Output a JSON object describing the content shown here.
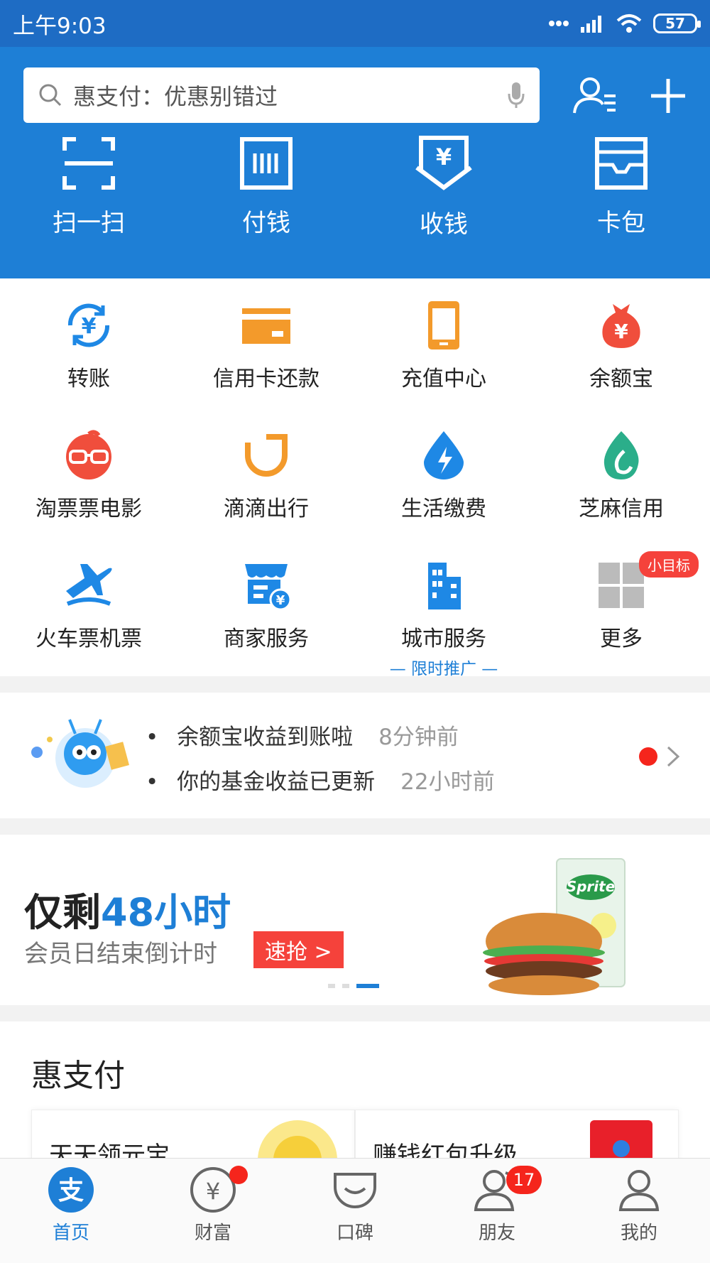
{
  "status_bar": {
    "time": "上午9:03",
    "battery": "57"
  },
  "header": {
    "search_placeholder": "惠支付：优惠别错过",
    "quick_actions": [
      {
        "label": "扫一扫",
        "icon": "scan-icon"
      },
      {
        "label": "付钱",
        "icon": "pay-icon"
      },
      {
        "label": "收钱",
        "icon": "receive-money-icon"
      },
      {
        "label": "卡包",
        "icon": "card-wallet-icon"
      }
    ]
  },
  "grid": {
    "items": [
      {
        "label": "转账",
        "icon": "transfer-icon"
      },
      {
        "label": "信用卡还款",
        "icon": "credit-card-icon"
      },
      {
        "label": "充值中心",
        "icon": "phone-recharge-icon"
      },
      {
        "label": "余额宝",
        "icon": "money-bag-icon"
      },
      {
        "label": "淘票票电影",
        "icon": "movie-glasses-icon"
      },
      {
        "label": "滴滴出行",
        "icon": "didi-icon"
      },
      {
        "label": "生活缴费",
        "icon": "lightning-drop-icon"
      },
      {
        "label": "芝麻信用",
        "icon": "sesame-credit-icon"
      },
      {
        "label": "火车票机票",
        "icon": "train-plane-icon"
      },
      {
        "label": "商家服务",
        "icon": "merchant-icon"
      },
      {
        "label": "城市服务",
        "icon": "city-icon"
      },
      {
        "label": "更多",
        "icon": "more-grid-icon"
      }
    ],
    "promo_tag": "— 限时推广 —",
    "more_badge": "小目标"
  },
  "notices": {
    "items": [
      {
        "text": "余额宝收益到账啦",
        "time": "8分钟前"
      },
      {
        "text": "你的基金收益已更新",
        "time": "22小时前"
      }
    ]
  },
  "banner": {
    "headline_prefix": "仅剩",
    "headline_highlight": "48小时",
    "subtitle": "会员日结束倒计时",
    "button": "速抢 >"
  },
  "hui_section": {
    "title": "惠支付",
    "cards": [
      {
        "title": "天天领元宝"
      },
      {
        "title": "赚钱红包升级"
      }
    ]
  },
  "tabbar": {
    "tabs": [
      {
        "label": "首页",
        "icon": "alipay-home-icon"
      },
      {
        "label": "财富",
        "icon": "wealth-icon"
      },
      {
        "label": "口碑",
        "icon": "koubei-icon"
      },
      {
        "label": "朋友",
        "icon": "friends-icon"
      },
      {
        "label": "我的",
        "icon": "profile-icon"
      }
    ],
    "friends_badge": "17"
  },
  "colors": {
    "brand_blue": "#1e7fd6",
    "badge_red": "#f5251c"
  }
}
